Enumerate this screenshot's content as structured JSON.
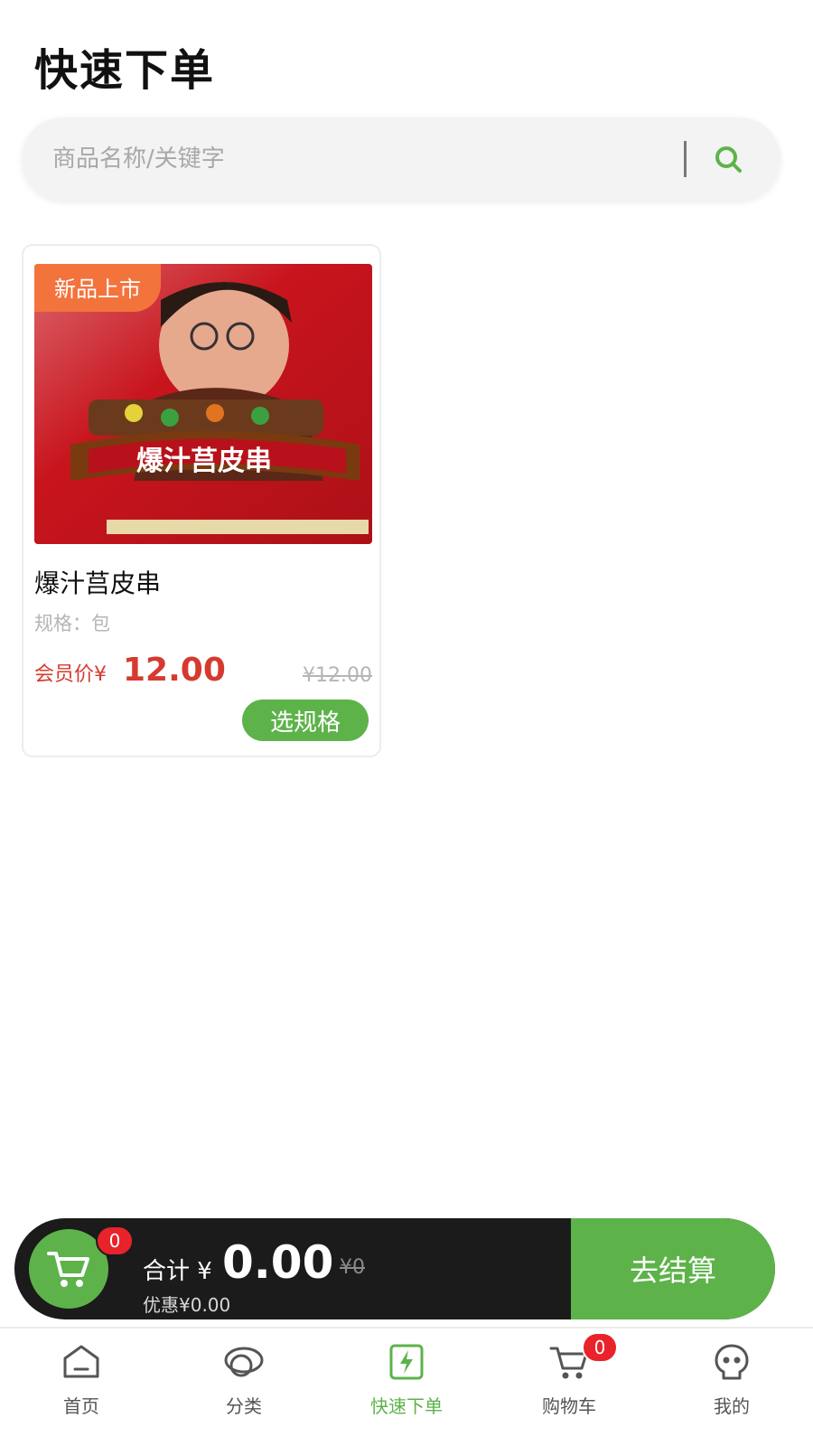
{
  "page": {
    "title": "快速下单"
  },
  "search": {
    "placeholder": "商品名称/关键字",
    "icon": "search-icon"
  },
  "product": {
    "badge": "新品上市",
    "name": "爆汁莒皮串",
    "spec": "规格：包",
    "member_label": "会员价¥",
    "member_price": "12.00",
    "original_price": "¥12.00",
    "button_label": "选规格",
    "image_caption": "爆汁莒皮串"
  },
  "checkout": {
    "cart_count": "0",
    "total_label": "合计 ¥",
    "total_amount": "0.00",
    "total_original": "¥0",
    "discount": "优惠¥0.00",
    "button_label": "去结算"
  },
  "tabs": [
    {
      "label": "首页",
      "icon": "home-icon"
    },
    {
      "label": "分类",
      "icon": "category-icon"
    },
    {
      "label": "快速下单",
      "icon": "quick-order-icon",
      "active": true
    },
    {
      "label": "购物车",
      "icon": "cart-icon",
      "badge": "0"
    },
    {
      "label": "我的",
      "icon": "profile-icon"
    }
  ],
  "colors": {
    "accent": "#5db34a",
    "price": "#d63a2f",
    "badge": "#f3733d",
    "count_badge": "#e8232a",
    "checkout_bar": "#1b1b1b"
  }
}
